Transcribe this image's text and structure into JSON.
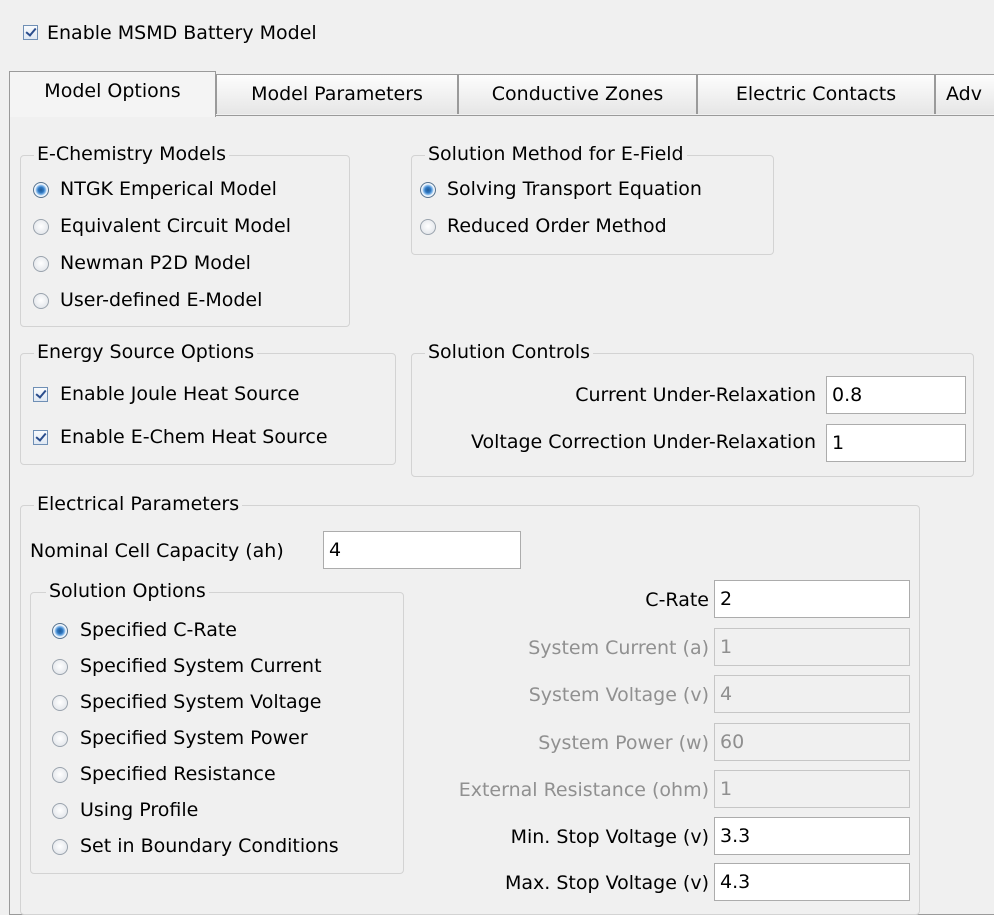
{
  "enable_msmd": {
    "label": "Enable MSMD Battery Model",
    "checked": true
  },
  "tabs": [
    {
      "label": "Model Options",
      "active": true
    },
    {
      "label": "Model Parameters",
      "active": false
    },
    {
      "label": "Conductive Zones",
      "active": false
    },
    {
      "label": "Electric Contacts",
      "active": false
    },
    {
      "label": "Adv",
      "active": false
    }
  ],
  "echem": {
    "title": "E-Chemistry Models",
    "options": [
      {
        "label": "NTGK Emperical Model",
        "selected": true
      },
      {
        "label": "Equivalent Circuit Model",
        "selected": false
      },
      {
        "label": "Newman P2D Model",
        "selected": false
      },
      {
        "label": "User-defined E-Model",
        "selected": false
      }
    ]
  },
  "solution_method": {
    "title": "Solution Method for E-Field",
    "options": [
      {
        "label": "Solving Transport Equation",
        "selected": true
      },
      {
        "label": "Reduced Order Method",
        "selected": false
      }
    ]
  },
  "energy_source": {
    "title": "Energy Source Options",
    "options": [
      {
        "label": "Enable Joule Heat Source",
        "checked": true
      },
      {
        "label": "Enable E-Chem Heat Source",
        "checked": true
      }
    ]
  },
  "solution_controls": {
    "title": "Solution Controls",
    "current_label": "Current Under-Relaxation",
    "current_value": "0.8",
    "voltage_label": "Voltage Correction Under-Relaxation",
    "voltage_value": "1"
  },
  "electrical": {
    "title": "Electrical Parameters",
    "capacity_label": "Nominal Cell Capacity  (ah)",
    "capacity_value": "4",
    "solution_options": {
      "title": "Solution Options",
      "options": [
        {
          "label": "Specified C-Rate",
          "selected": true
        },
        {
          "label": "Specified System Current",
          "selected": false
        },
        {
          "label": "Specified System Voltage",
          "selected": false
        },
        {
          "label": "Specified System Power",
          "selected": false
        },
        {
          "label": "Specified Resistance",
          "selected": false
        },
        {
          "label": "Using Profile",
          "selected": false
        },
        {
          "label": "Set in Boundary Conditions",
          "selected": false
        }
      ]
    },
    "fields": [
      {
        "label": "C-Rate",
        "value": "2",
        "enabled": true
      },
      {
        "label": "System Current  (a)",
        "value": "1",
        "enabled": false
      },
      {
        "label": "System Voltage  (v)",
        "value": "4",
        "enabled": false
      },
      {
        "label": "System Power  (w)",
        "value": "60",
        "enabled": false
      },
      {
        "label": "External Resistance  (ohm)",
        "value": "1",
        "enabled": false
      },
      {
        "label": "Min. Stop Voltage  (v)",
        "value": "3.3",
        "enabled": true
      },
      {
        "label": "Max. Stop Voltage  (v)",
        "value": "4.3",
        "enabled": true
      }
    ]
  }
}
